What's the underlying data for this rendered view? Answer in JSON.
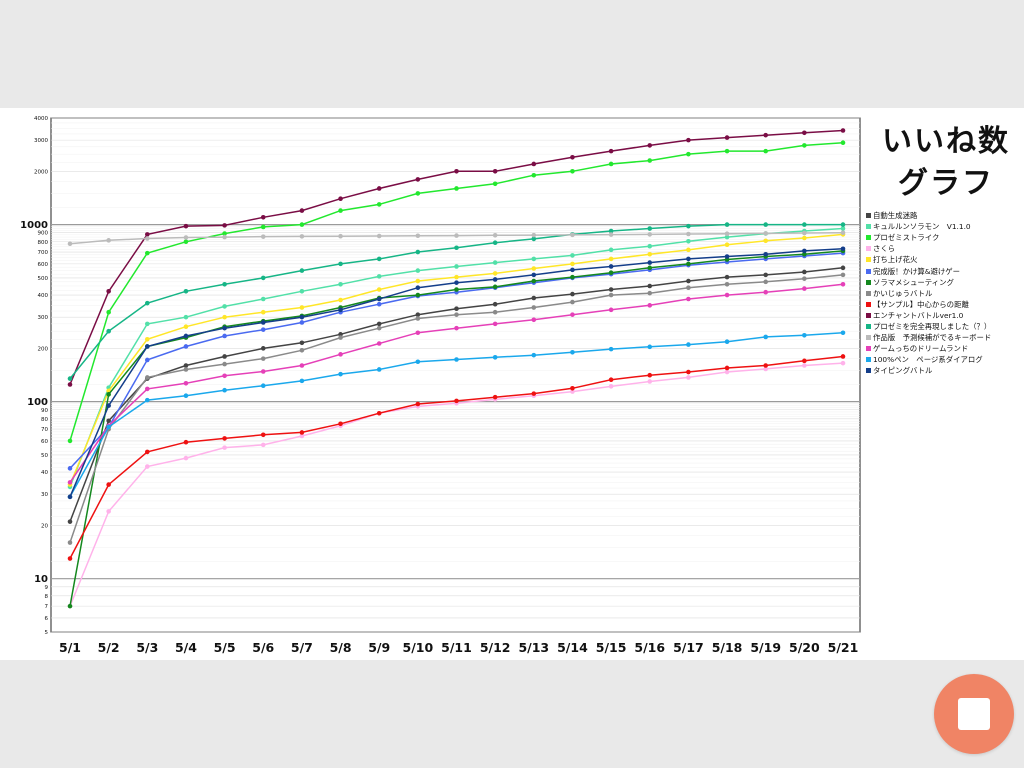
{
  "title_line1": "いいね数",
  "title_line2": "グラフ",
  "chart_data": {
    "type": "line",
    "scale": "log",
    "ylim": [
      5,
      4000
    ],
    "grid": true,
    "legend_position": "right",
    "categories": [
      "5/1",
      "5/2",
      "5/3",
      "5/4",
      "5/5",
      "5/6",
      "5/7",
      "5/8",
      "5/9",
      "5/10",
      "5/11",
      "5/12",
      "5/13",
      "5/14",
      "5/15",
      "5/16",
      "5/17",
      "5/18",
      "5/19",
      "5/20",
      "5/21"
    ],
    "y_ticks": [
      {
        "v": 5,
        "label": "5"
      },
      {
        "v": 6,
        "label": "6"
      },
      {
        "v": 7,
        "label": "7"
      },
      {
        "v": 8,
        "label": "8"
      },
      {
        "v": 9,
        "label": "9"
      },
      {
        "v": 10,
        "label": "10",
        "major": true
      },
      {
        "v": 20,
        "label": "20"
      },
      {
        "v": 30,
        "label": "30"
      },
      {
        "v": 40,
        "label": "40"
      },
      {
        "v": 50,
        "label": "50"
      },
      {
        "v": 60,
        "label": "60"
      },
      {
        "v": 70,
        "label": "70"
      },
      {
        "v": 80,
        "label": "80"
      },
      {
        "v": 90,
        "label": "90"
      },
      {
        "v": 100,
        "label": "100",
        "major": true
      },
      {
        "v": 200,
        "label": "200"
      },
      {
        "v": 300,
        "label": "300"
      },
      {
        "v": 400,
        "label": "400"
      },
      {
        "v": 500,
        "label": "500"
      },
      {
        "v": 600,
        "label": "600"
      },
      {
        "v": 700,
        "label": "700"
      },
      {
        "v": 800,
        "label": "800"
      },
      {
        "v": 900,
        "label": "900"
      },
      {
        "v": 1000,
        "label": "1000",
        "major": true
      },
      {
        "v": 2000,
        "label": "2000"
      },
      {
        "v": 3000,
        "label": "3000"
      },
      {
        "v": 4000,
        "label": "4000"
      }
    ],
    "series": [
      {
        "name": "自動生成迷路",
        "color": "#444444",
        "values": [
          21,
          78,
          135,
          160,
          180,
          200,
          215,
          240,
          275,
          310,
          335,
          355,
          385,
          405,
          430,
          450,
          480,
          505,
          520,
          540,
          570
        ]
      },
      {
        "name": "キュルルンソラモン　V1.1.0",
        "color": "#52e0a8",
        "values": [
          33,
          120,
          275,
          300,
          345,
          380,
          420,
          460,
          510,
          550,
          580,
          610,
          640,
          670,
          720,
          755,
          805,
          850,
          890,
          920,
          950
        ]
      },
      {
        "name": "プロゼミストライク",
        "color": "#22e82e",
        "values": [
          60,
          320,
          690,
          800,
          890,
          970,
          1000,
          1200,
          1300,
          1500,
          1600,
          1700,
          1900,
          2000,
          2200,
          2300,
          2500,
          2600,
          2600,
          2800,
          2900
        ]
      },
      {
        "name": "さくら",
        "color": "#ffb2ea",
        "values": [
          7,
          24,
          43,
          48,
          55,
          57,
          64,
          73,
          86,
          94,
          98,
          103,
          108,
          114,
          122,
          130,
          137,
          147,
          153,
          160,
          165
        ]
      },
      {
        "name": "打ち上げ花火",
        "color": "#ffe628",
        "values": [
          34,
          115,
          225,
          265,
          300,
          320,
          340,
          375,
          430,
          480,
          505,
          530,
          565,
          600,
          640,
          680,
          720,
          770,
          810,
          840,
          880
        ]
      },
      {
        "name": "完成版！かけ算&避けゲー",
        "color": "#4a6af0",
        "values": [
          42,
          72,
          172,
          205,
          235,
          255,
          280,
          320,
          355,
          395,
          415,
          440,
          470,
          500,
          525,
          555,
          590,
          615,
          640,
          665,
          690
        ]
      },
      {
        "name": "ソラマメシューティング",
        "color": "#14881e",
        "values": [
          7,
          110,
          205,
          230,
          265,
          285,
          305,
          340,
          385,
          400,
          430,
          445,
          480,
          505,
          535,
          570,
          600,
          635,
          660,
          680,
          710
        ]
      },
      {
        "name": "かいじゅうバトル",
        "color": "#8a8a8a",
        "values": [
          16,
          70,
          137,
          152,
          163,
          175,
          195,
          230,
          260,
          295,
          310,
          320,
          340,
          365,
          400,
          410,
          440,
          460,
          475,
          495,
          520
        ]
      },
      {
        "name": "【サンプル】中心からの距離",
        "color": "#ee1111",
        "values": [
          13,
          34,
          52,
          59,
          62,
          65,
          67,
          75,
          86,
          97,
          101,
          106,
          111,
          119,
          133,
          141,
          147,
          155,
          160,
          170,
          180
        ]
      },
      {
        "name": "エンチャントバトルver1.0",
        "color": "#7a0d45",
        "values": [
          125,
          420,
          880,
          980,
          990,
          1100,
          1200,
          1400,
          1600,
          1800,
          2000,
          2000,
          2200,
          2400,
          2600,
          2800,
          3000,
          3100,
          3200,
          3300,
          3400
        ]
      },
      {
        "name": "プロゼミを完全再現しました（？）",
        "color": "#16b586",
        "values": [
          135,
          250,
          360,
          420,
          460,
          500,
          550,
          600,
          640,
          700,
          740,
          790,
          830,
          880,
          920,
          950,
          980,
          1000,
          1000,
          1000,
          1000
        ]
      },
      {
        "name": "作品版　予測候補がでるキーボード",
        "color": "#bbbbbb",
        "values": [
          780,
          815,
          835,
          845,
          850,
          855,
          858,
          860,
          862,
          865,
          867,
          870,
          872,
          875,
          878,
          880,
          885,
          888,
          892,
          896,
          900
        ]
      },
      {
        "name": "ゲームっちのドリームランド",
        "color": "#e540b8",
        "values": [
          35,
          73,
          118,
          127,
          140,
          148,
          160,
          185,
          213,
          245,
          260,
          275,
          290,
          310,
          330,
          350,
          380,
          400,
          415,
          435,
          460
        ]
      },
      {
        "name": "100%ペン　ページ系ダイアログ",
        "color": "#1aa8ec",
        "values": [
          29,
          72,
          102,
          108,
          116,
          123,
          131,
          143,
          152,
          168,
          173,
          178,
          183,
          190,
          198,
          204,
          210,
          218,
          232,
          237,
          245
        ]
      },
      {
        "name": "タイピングバトル",
        "color": "#143e8a",
        "values": [
          29,
          95,
          205,
          235,
          260,
          280,
          300,
          330,
          380,
          440,
          470,
          490,
          520,
          555,
          580,
          610,
          640,
          660,
          680,
          710,
          730
        ]
      }
    ]
  }
}
